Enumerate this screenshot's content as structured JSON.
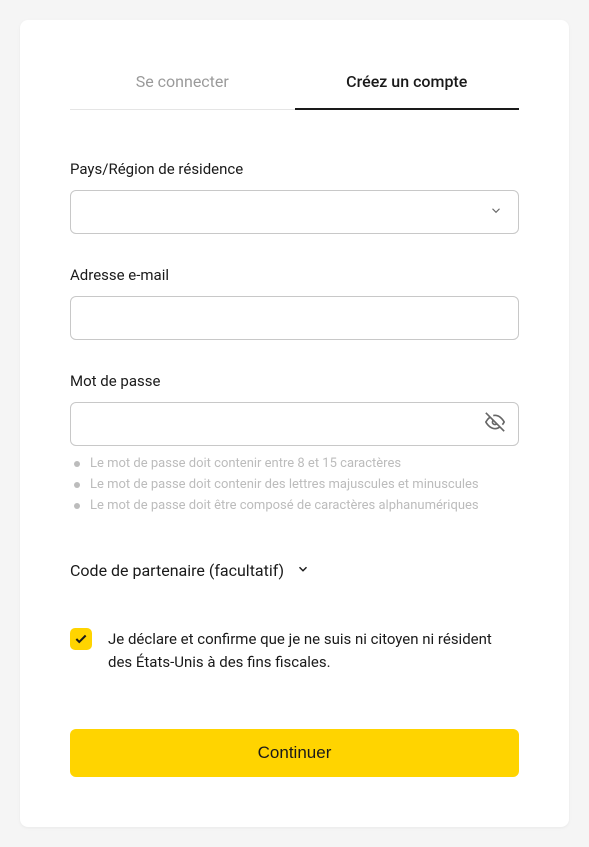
{
  "tabs": {
    "login": "Se connecter",
    "signup": "Créez un compte"
  },
  "fields": {
    "country": {
      "label": "Pays/Région de résidence",
      "value": ""
    },
    "email": {
      "label": "Adresse e-mail",
      "value": ""
    },
    "password": {
      "label": "Mot de passe",
      "value": ""
    }
  },
  "password_hints": [
    "Le mot de passe doit contenir entre 8 et 15 caractères",
    "Le mot de passe doit contenir des lettres majuscules et minuscules",
    "Le mot de passe doit être composé de caractères alphanumériques"
  ],
  "partner_code": {
    "label": "Code de partenaire (facultatif)"
  },
  "declaration": {
    "checked": true,
    "text": "Je déclare et confirme que je ne suis ni citoyen ni résident des États-Unis à des fins fiscales."
  },
  "submit": {
    "label": "Continuer"
  }
}
